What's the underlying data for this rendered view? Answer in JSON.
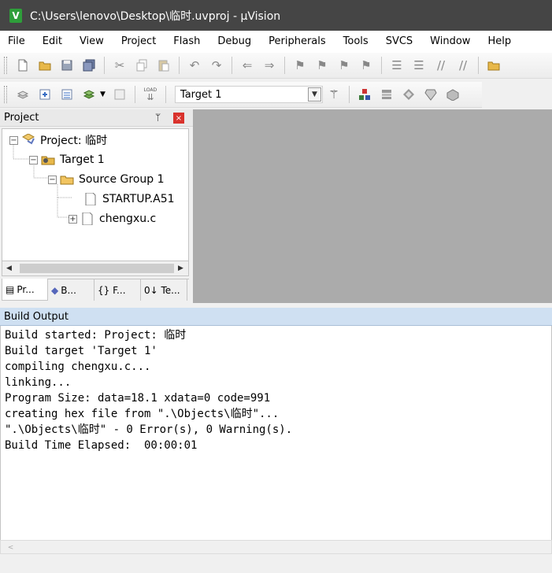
{
  "window": {
    "title": "C:\\Users\\lenovo\\Desktop\\临时.uvproj - µVision",
    "app_icon_letter": "V"
  },
  "menu": [
    "File",
    "Edit",
    "View",
    "Project",
    "Flash",
    "Debug",
    "Peripherals",
    "Tools",
    "SVCS",
    "Window",
    "Help"
  ],
  "toolbar2": {
    "load_label": "LOAD",
    "target_value": "Target 1"
  },
  "project_panel": {
    "title": "Project",
    "pin": "ᛘ",
    "close": "×",
    "tree": {
      "project": "Project: 临时",
      "target": "Target 1",
      "group": "Source Group 1",
      "file1": "STARTUP.A51",
      "file2": "chengxu.c"
    },
    "tabs": [
      "Pr...",
      "B...",
      "{} F...",
      "0↓ Te..."
    ]
  },
  "build": {
    "title": "Build Output",
    "lines": [
      "Build started: Project: 临时",
      "Build target 'Target 1'",
      "compiling chengxu.c...",
      "linking...",
      "Program Size: data=18.1 xdata=0 code=991",
      "creating hex file from \".\\Objects\\临时\"...",
      "\".\\Objects\\临时\" - 0 Error(s), 0 Warning(s).",
      "Build Time Elapsed:  00:00:01"
    ]
  },
  "colors": {
    "titlebar": "#454545",
    "editor_bg": "#ababab",
    "build_header": "#cfe0f2",
    "close_red": "#d9322c"
  }
}
